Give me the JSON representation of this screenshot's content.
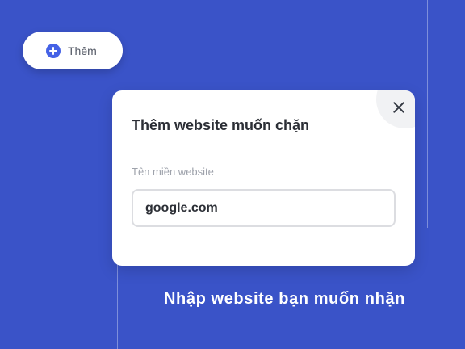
{
  "add_button": {
    "label": "Thêm",
    "icon": "plus-circle-icon"
  },
  "dialog": {
    "title": "Thêm website muốn chặn",
    "field_label": "Tên miền website",
    "input_value": "google.com",
    "close_icon": "close-icon"
  },
  "caption": "Nhập website bạn muốn nhặn",
  "colors": {
    "background": "#3a53c8",
    "accent": "#4562e6",
    "dialog": "#ffffff",
    "close_bg": "#f1f2f4",
    "title_text": "#2c2f36",
    "label_text": "#9ea2ab"
  }
}
